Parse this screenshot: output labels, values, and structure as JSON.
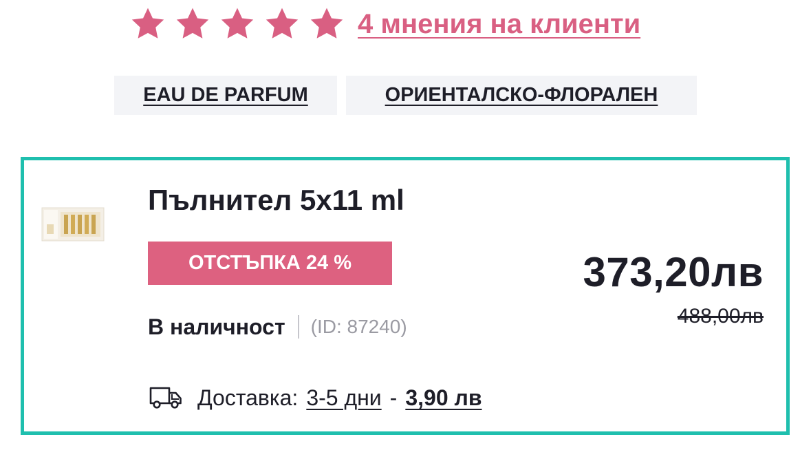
{
  "rating": {
    "stars": 5,
    "max_stars": 5,
    "reviews_link": "4 мнения на клиенти"
  },
  "tags": [
    {
      "label": "EAU DE PARFUM"
    },
    {
      "label": "ОРИЕНТАЛСКО-ФЛОРАЛЕН"
    }
  ],
  "variant": {
    "name": "Пълнител 5x11 ml",
    "discount_badge": "ОТСТЪПКА 24 %",
    "stock_status": "В наличност",
    "product_id": "(ID: 87240)",
    "price": "373,20лв",
    "old_price": "488,00лв",
    "delivery": {
      "label": "Доставка:",
      "days": "3-5 дни",
      "separator": "-",
      "cost": "3,90 лв"
    }
  },
  "colors": {
    "accent_pink": "#d95f82",
    "badge_pink": "#dd6180",
    "selected_border": "#1fbfae",
    "tag_background": "#f3f4f7",
    "text": "#1e1e28",
    "muted_text": "#9a9aa2"
  },
  "icons": {
    "rating": "star-icon",
    "delivery": "delivery-truck-icon"
  }
}
